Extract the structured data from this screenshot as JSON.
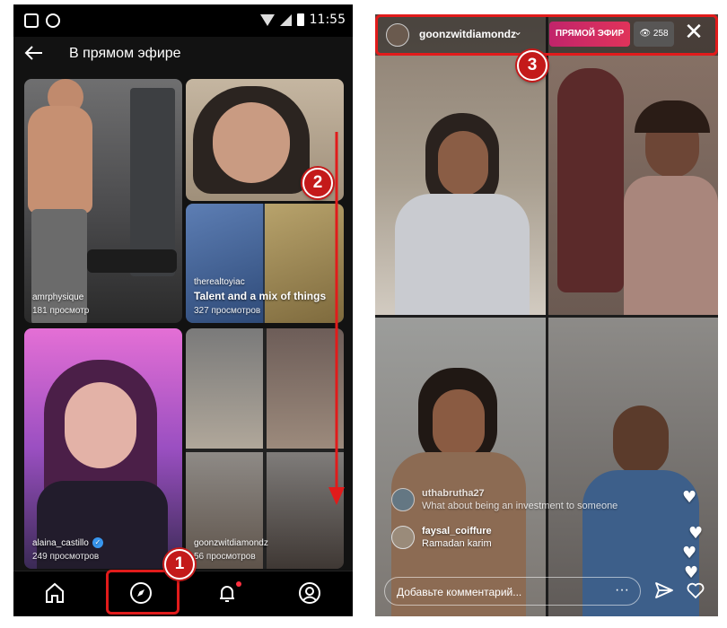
{
  "left_phone": {
    "status_bar": {
      "time": "11:55"
    },
    "top_bar": {
      "title": "В прямом эфире"
    },
    "tiles": [
      {
        "user": "amrphysique",
        "title": "",
        "views": "181 просмотр",
        "verified": false
      },
      {
        "user": "therealtoyiac",
        "title": "Talent and a mix of things",
        "views": "327 просмотров",
        "verified": false
      },
      {
        "user": "alaina_castillo",
        "title": "",
        "views": "249 просмотров",
        "verified": true
      },
      {
        "user": "goonzwitdiamondz",
        "title": "",
        "views": "56 просмотров",
        "verified": false
      }
    ],
    "bottom_nav": [
      {
        "icon": "home-icon"
      },
      {
        "icon": "compass-icon"
      },
      {
        "icon": "bell-icon"
      },
      {
        "icon": "profile-icon"
      }
    ]
  },
  "right_phone": {
    "header": {
      "host": "goonzwitdiamondz",
      "live_label": "ПРЯМОЙ ЭФИР",
      "viewer_count": "258"
    },
    "comments": [
      {
        "user": "uthabrutha27",
        "text": "What about being an investment to someone"
      },
      {
        "user": "faysal_coiffure",
        "text": "Ramadan karim"
      }
    ],
    "comment_input": {
      "placeholder": "Добавьте комментарий...",
      "more": "···"
    }
  },
  "annotations": {
    "badge_1": "1",
    "badge_2": "2",
    "badge_3": "3"
  },
  "colors": {
    "annotation_red": "#e11b1b",
    "live_badge": "#d12a62",
    "verified_blue": "#3897f0"
  }
}
